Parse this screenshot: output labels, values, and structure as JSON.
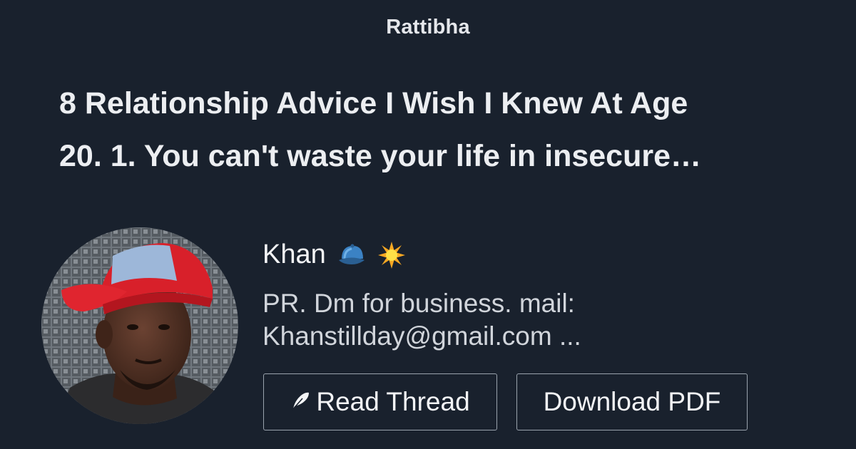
{
  "brand": "Rattibha",
  "thread": {
    "title_line1": "8 Relationship Advice I Wish I Knew At Age",
    "title_line2": "20. 1. You can't waste your life in insecure…"
  },
  "author": {
    "name": "Khan",
    "emoji_icons": [
      "cap-icon",
      "sun-icon"
    ],
    "bio_line1": "PR. Dm for business. mail:",
    "bio_line2": "Khanstillday@gmail.com ..."
  },
  "buttons": {
    "read_thread": "Read Thread",
    "read_thread_icon": "feather-icon",
    "download_pdf": "Download PDF"
  },
  "colors": {
    "background": "#19212d",
    "text": "#f3f4f6",
    "button_border": "#9aa3ad"
  }
}
